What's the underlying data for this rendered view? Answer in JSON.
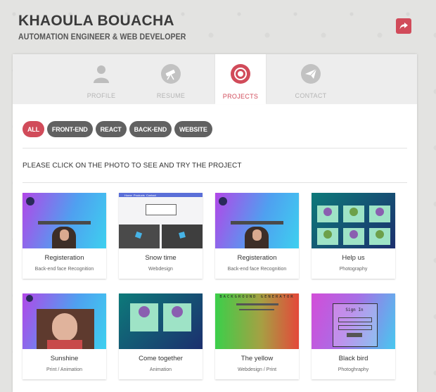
{
  "header": {
    "name": "KHAOULA BOUACHA",
    "subtitle": "AUTOMATION ENGINEER & WEB DEVELOPER"
  },
  "tabs": [
    {
      "label": "PROFILE",
      "icon": "user-icon"
    },
    {
      "label": "RESUME",
      "icon": "telescope-icon"
    },
    {
      "label": "PROJECTS",
      "icon": "projects-icon"
    },
    {
      "label": "CONTACT",
      "icon": "paper-plane-icon"
    }
  ],
  "filters": [
    "ALL",
    "FRONT-END",
    "REACT",
    "BACK-END",
    "WEBSITE"
  ],
  "notice": "PLEASE CLICK ON THE PHOTO TO SEE AND TRY THE PROJECT",
  "projects": [
    {
      "title": "Registeration",
      "category": "Back-end face Recognition"
    },
    {
      "title": "Snow time",
      "category": "Webdesign"
    },
    {
      "title": "Registeration",
      "category": "Back-end face Recognition"
    },
    {
      "title": "Help us",
      "category": "Photography"
    },
    {
      "title": "Sunshine",
      "category": "Print / Animation"
    },
    {
      "title": "Come together",
      "category": "Animation"
    },
    {
      "title": "The yellow",
      "category": "Webdesign / Print"
    },
    {
      "title": "Black bird",
      "category": "Photoghraphy"
    }
  ],
  "thumbnail_text": {
    "bg_generator": "BACKGROUND GENERATOR",
    "sign_in": "Sign In",
    "nav_1": "Home",
    "nav_2": "Products",
    "nav_3": "Contact"
  },
  "colors": {
    "accent": "#d14b5a",
    "chip": "#616161",
    "tab_bar": "#ededed"
  }
}
